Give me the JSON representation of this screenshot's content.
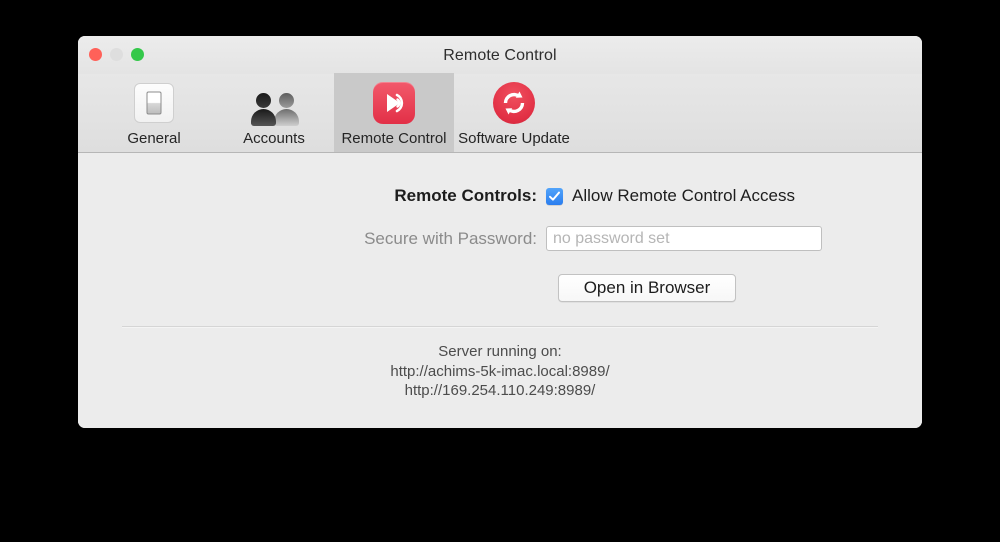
{
  "window": {
    "title": "Remote Control",
    "traffic_lights": [
      {
        "name": "close",
        "color": "#ff6159"
      },
      {
        "name": "minimize",
        "color": "#dedede"
      },
      {
        "name": "zoom",
        "color": "#34c84a"
      }
    ]
  },
  "toolbar": {
    "tabs": [
      {
        "label": "General",
        "icon": "light-switch-icon",
        "selected": false
      },
      {
        "label": "Accounts",
        "icon": "people-icon",
        "selected": false
      },
      {
        "label": "Remote Control",
        "icon": "airplay-icon",
        "selected": true
      },
      {
        "label": "Software Update",
        "icon": "refresh-icon",
        "selected": false
      }
    ],
    "selected_tab": "Remote Control"
  },
  "content": {
    "remote_controls_label": "Remote Controls:",
    "allow_access_label": "Allow Remote Control Access",
    "allow_access_checked": true,
    "password_label": "Secure with Password:",
    "password_value": "",
    "password_placeholder": "no password set",
    "open_browser_button": "Open in Browser",
    "server_heading": "Server running on:",
    "server_urls": [
      "http://achims-5k-imac.local:8989/",
      "http://169.254.110.249:8989/"
    ],
    "help_label": "?"
  },
  "colors": {
    "accent_checkbox": "#3b8cf4",
    "icon_red": "#e23047",
    "help_blue": "#2f7fe0",
    "window_bg": "#ececec",
    "toolbar_selected": "#c9c9c9"
  }
}
